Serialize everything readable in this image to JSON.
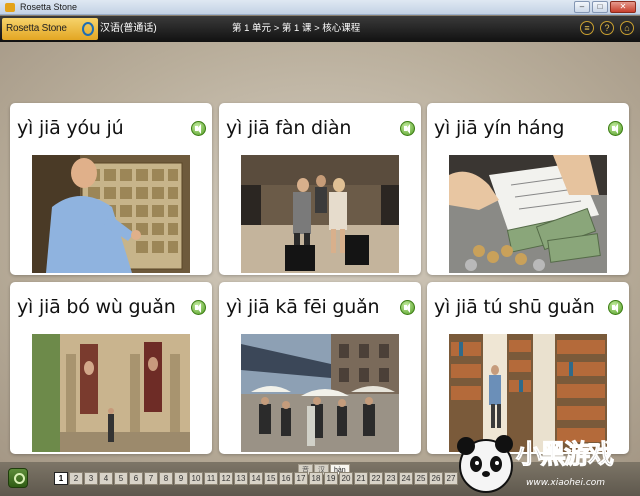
{
  "window": {
    "title": "Rosetta Stone"
  },
  "appbar": {
    "logo": "Rosetta Stone",
    "language": "汉语(普通话)",
    "breadcrumb": "第 1 单元 > 第 1 课 > 核心课程",
    "icons": [
      "menu-icon",
      "help-icon",
      "home-icon"
    ]
  },
  "cards": [
    {
      "word": "yì jiā yóu jú",
      "image": "man sorting mail in post office boxes"
    },
    {
      "word": "yì jiā fàn diàn",
      "image": "travelers with luggage at hotel desk"
    },
    {
      "word": "yì jiā yín háng",
      "image": "hands counting money at bank counter"
    },
    {
      "word": "yì jiā bó wù guǎn",
      "image": "museum facade with banners"
    },
    {
      "word": "yì jiā kā fēi guǎn",
      "image": "outdoor cafe with umbrellas"
    },
    {
      "word": "yì jiā tú shū guǎn",
      "image": "library bookshelves"
    }
  ],
  "bottom": {
    "modes": [
      "音",
      "汉",
      "hàn"
    ],
    "pages": [
      "1",
      "2",
      "3",
      "4",
      "5",
      "6",
      "7",
      "8",
      "9",
      "10",
      "11",
      "12",
      "13",
      "14",
      "15",
      "16",
      "17",
      "18",
      "19",
      "20",
      "21",
      "22",
      "23",
      "24",
      "25",
      "26",
      "27"
    ],
    "current_page": "1"
  },
  "watermark": {
    "text": "小黑游戏",
    "url": "www.xiaohei.com"
  }
}
